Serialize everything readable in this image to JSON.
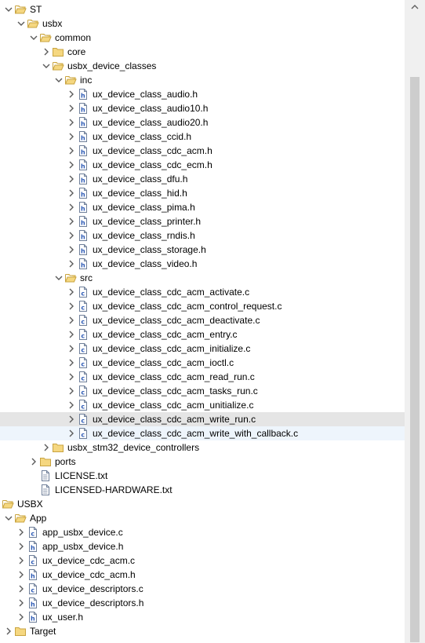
{
  "tree": {
    "rows": [
      {
        "label": "ST",
        "kind": "folder",
        "expanded": true,
        "level": 0,
        "has_chevron": true,
        "icon_name": "folder-icon"
      },
      {
        "label": "usbx",
        "kind": "folder",
        "expanded": true,
        "level": 1,
        "has_chevron": true,
        "icon_name": "folder-icon"
      },
      {
        "label": "common",
        "kind": "folder",
        "expanded": true,
        "level": 2,
        "has_chevron": true,
        "icon_name": "folder-icon"
      },
      {
        "label": "core",
        "kind": "folder",
        "expanded": false,
        "level": 3,
        "has_chevron": true,
        "icon_name": "folder-icon"
      },
      {
        "label": "usbx_device_classes",
        "kind": "folder",
        "expanded": true,
        "level": 3,
        "has_chevron": true,
        "icon_name": "folder-icon"
      },
      {
        "label": "inc",
        "kind": "folder",
        "expanded": true,
        "level": 4,
        "has_chevron": true,
        "icon_name": "folder-icon"
      },
      {
        "label": "ux_device_class_audio.h",
        "kind": "h",
        "level": 5,
        "has_chevron": true,
        "icon_name": "header-file-icon"
      },
      {
        "label": "ux_device_class_audio10.h",
        "kind": "h",
        "level": 5,
        "has_chevron": true,
        "icon_name": "header-file-icon"
      },
      {
        "label": "ux_device_class_audio20.h",
        "kind": "h",
        "level": 5,
        "has_chevron": true,
        "icon_name": "header-file-icon"
      },
      {
        "label": "ux_device_class_ccid.h",
        "kind": "h",
        "level": 5,
        "has_chevron": true,
        "icon_name": "header-file-icon"
      },
      {
        "label": "ux_device_class_cdc_acm.h",
        "kind": "h",
        "level": 5,
        "has_chevron": true,
        "icon_name": "header-file-icon"
      },
      {
        "label": "ux_device_class_cdc_ecm.h",
        "kind": "h",
        "level": 5,
        "has_chevron": true,
        "icon_name": "header-file-icon"
      },
      {
        "label": "ux_device_class_dfu.h",
        "kind": "h",
        "level": 5,
        "has_chevron": true,
        "icon_name": "header-file-icon"
      },
      {
        "label": "ux_device_class_hid.h",
        "kind": "h",
        "level": 5,
        "has_chevron": true,
        "icon_name": "header-file-icon"
      },
      {
        "label": "ux_device_class_pima.h",
        "kind": "h",
        "level": 5,
        "has_chevron": true,
        "icon_name": "header-file-icon"
      },
      {
        "label": "ux_device_class_printer.h",
        "kind": "h",
        "level": 5,
        "has_chevron": true,
        "icon_name": "header-file-icon"
      },
      {
        "label": "ux_device_class_rndis.h",
        "kind": "h",
        "level": 5,
        "has_chevron": true,
        "icon_name": "header-file-icon"
      },
      {
        "label": "ux_device_class_storage.h",
        "kind": "h",
        "level": 5,
        "has_chevron": true,
        "icon_name": "header-file-icon"
      },
      {
        "label": "ux_device_class_video.h",
        "kind": "h",
        "level": 5,
        "has_chevron": true,
        "icon_name": "header-file-icon"
      },
      {
        "label": "src",
        "kind": "folder",
        "expanded": true,
        "level": 4,
        "has_chevron": true,
        "icon_name": "folder-icon"
      },
      {
        "label": "ux_device_class_cdc_acm_activate.c",
        "kind": "c",
        "level": 5,
        "has_chevron": true,
        "icon_name": "c-file-icon"
      },
      {
        "label": "ux_device_class_cdc_acm_control_request.c",
        "kind": "c",
        "level": 5,
        "has_chevron": true,
        "icon_name": "c-file-icon"
      },
      {
        "label": "ux_device_class_cdc_acm_deactivate.c",
        "kind": "c",
        "level": 5,
        "has_chevron": true,
        "icon_name": "c-file-icon"
      },
      {
        "label": "ux_device_class_cdc_acm_entry.c",
        "kind": "c",
        "level": 5,
        "has_chevron": true,
        "icon_name": "c-file-icon"
      },
      {
        "label": "ux_device_class_cdc_acm_initialize.c",
        "kind": "c",
        "level": 5,
        "has_chevron": true,
        "icon_name": "c-file-icon"
      },
      {
        "label": "ux_device_class_cdc_acm_ioctl.c",
        "kind": "c",
        "level": 5,
        "has_chevron": true,
        "icon_name": "c-file-icon"
      },
      {
        "label": "ux_device_class_cdc_acm_read_run.c",
        "kind": "c",
        "level": 5,
        "has_chevron": true,
        "icon_name": "c-file-icon"
      },
      {
        "label": "ux_device_class_cdc_acm_tasks_run.c",
        "kind": "c",
        "level": 5,
        "has_chevron": true,
        "icon_name": "c-file-icon"
      },
      {
        "label": "ux_device_class_cdc_acm_unitialize.c",
        "kind": "c",
        "level": 5,
        "has_chevron": true,
        "icon_name": "c-file-icon"
      },
      {
        "label": "ux_device_class_cdc_acm_write_run.c",
        "kind": "c",
        "level": 5,
        "has_chevron": true,
        "icon_name": "c-file-icon",
        "selected": true
      },
      {
        "label": "ux_device_class_cdc_acm_write_with_callback.c",
        "kind": "c",
        "level": 5,
        "has_chevron": true,
        "icon_name": "c-file-icon",
        "hovered": true
      },
      {
        "label": "usbx_stm32_device_controllers",
        "kind": "folder",
        "expanded": false,
        "level": 3,
        "has_chevron": true,
        "icon_name": "folder-icon"
      },
      {
        "label": "ports",
        "kind": "folder",
        "expanded": false,
        "level": 2,
        "has_chevron": true,
        "icon_name": "folder-icon"
      },
      {
        "label": "LICENSE.txt",
        "kind": "txt",
        "level": 2,
        "has_chevron": false,
        "icon_name": "text-file-icon"
      },
      {
        "label": "LICENSED-HARDWARE.txt",
        "kind": "txt",
        "level": 2,
        "has_chevron": false,
        "icon_name": "text-file-icon"
      },
      {
        "label": "USBX",
        "kind": "folder",
        "expanded": true,
        "level": 0,
        "has_chevron": true,
        "icon_name": "folder-icon",
        "root": true
      },
      {
        "label": "App",
        "kind": "folder",
        "expanded": true,
        "level": 1,
        "has_chevron": true,
        "icon_name": "folder-icon",
        "root": true
      },
      {
        "label": "app_usbx_device.c",
        "kind": "c",
        "level": 2,
        "has_chevron": true,
        "icon_name": "c-file-icon",
        "root": true
      },
      {
        "label": "app_usbx_device.h",
        "kind": "h",
        "level": 2,
        "has_chevron": true,
        "icon_name": "header-file-icon",
        "root": true
      },
      {
        "label": "ux_device_cdc_acm.c",
        "kind": "c",
        "level": 2,
        "has_chevron": true,
        "icon_name": "c-file-icon",
        "root": true
      },
      {
        "label": "ux_device_cdc_acm.h",
        "kind": "h",
        "level": 2,
        "has_chevron": true,
        "icon_name": "header-file-icon",
        "root": true
      },
      {
        "label": "ux_device_descriptors.c",
        "kind": "c",
        "level": 2,
        "has_chevron": true,
        "icon_name": "c-file-icon",
        "root": true
      },
      {
        "label": "ux_device_descriptors.h",
        "kind": "h",
        "level": 2,
        "has_chevron": true,
        "icon_name": "header-file-icon",
        "root": true
      },
      {
        "label": "ux_user.h",
        "kind": "h",
        "level": 2,
        "has_chevron": true,
        "icon_name": "header-file-icon",
        "root": true
      },
      {
        "label": "Target",
        "kind": "folder",
        "expanded": false,
        "level": 1,
        "has_chevron": true,
        "icon_name": "folder-icon",
        "root": true
      }
    ]
  },
  "colors": {
    "folder_fill": "#f5d780",
    "folder_stroke": "#c9a441",
    "file_stroke": "#6f7f99",
    "c_letter": "#2d5ab5",
    "h_letter": "#2d5ab5",
    "selected_bg": "#e5e5e5",
    "hover_bg": "#eef5fc",
    "chevron": "#5a5a5a"
  },
  "scrollbar": {
    "up_icon": "chevron-up-icon"
  }
}
